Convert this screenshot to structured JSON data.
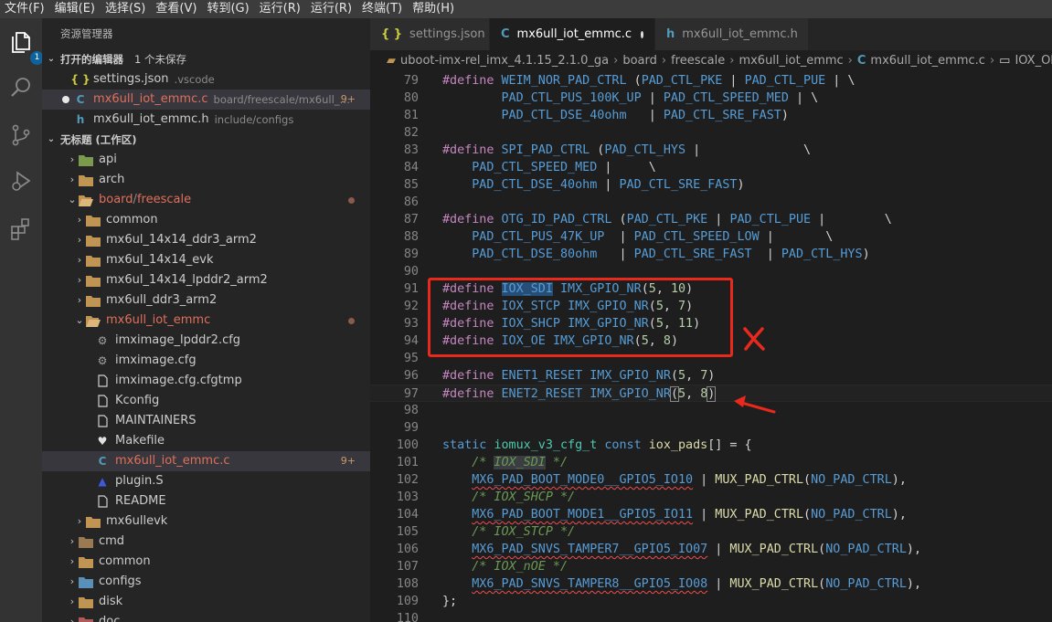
{
  "menubar": [
    "文件(F)",
    "编辑(E)",
    "选择(S)",
    "查看(V)",
    "转到(G)",
    "运行(R)",
    "运行(R)",
    "终端(T)",
    "帮助(H)"
  ],
  "activity": {
    "explorer_badge": "1"
  },
  "sidebar": {
    "title": "资源管理器",
    "open_editors": {
      "label": "打开的编辑器",
      "unsaved": "1 个未保存",
      "items": [
        {
          "icon": "{ }",
          "name": "settings.json",
          "desc": ".vscode"
        },
        {
          "icon": "C",
          "name": "mx6ull_iot_emmc.c",
          "desc": "board/freescale/mx6ull_i...",
          "badge": "9+"
        },
        {
          "icon": "h",
          "name": "mx6ull_iot_emmc.h",
          "desc": "include/configs"
        }
      ]
    },
    "workspace": {
      "label": "无标题 (工作区)",
      "tree": {
        "api": "api",
        "arch": "arch",
        "board": "board",
        "slash": " / ",
        "freescale": "freescale",
        "common": "common",
        "mx6ul_14x14_ddr3_arm2": "mx6ul_14x14_ddr3_arm2",
        "mx6ul_14x14_evk": "mx6ul_14x14_evk",
        "mx6ul_14x14_lpddr2_arm2": "mx6ul_14x14_lpddr2_arm2",
        "mx6ull_ddr3_arm2": "mx6ull_ddr3_arm2",
        "mx6ull_iot_emmc": "mx6ull_iot_emmc",
        "imximage_lpddr2": "imximage_lpddr2.cfg",
        "imximage": "imximage.cfg",
        "imximage_tmp": "imximage.cfg.cfgtmp",
        "kconfig": "Kconfig",
        "maintainers": "MAINTAINERS",
        "makefile": "Makefile",
        "emmc_c": "mx6ull_iot_emmc.c",
        "emmc_c_badge": "9+",
        "plugin": "plugin.S",
        "readme": "README",
        "mx6ullevk": "mx6ullevk",
        "cmd": "cmd",
        "common2": "common",
        "configs": "configs",
        "disk": "disk",
        "doc": "doc"
      }
    }
  },
  "tabs": [
    {
      "icon": "{ }",
      "label": "settings.json"
    },
    {
      "icon": "C",
      "label": "mx6ull_iot_emmc.c",
      "active": true,
      "dirty": true
    },
    {
      "icon": "h",
      "label": "mx6ull_iot_emmc.h"
    }
  ],
  "breadcrumb": [
    "uboot-imx-rel_imx_4.1.15_2.1.0_ga",
    "board",
    "freescale",
    "mx6ull_iot_emmc",
    "mx6ull_iot_emmc.c",
    "IOX_OE"
  ],
  "code": [
    {
      "n": "79",
      "t": [
        [
          "m",
          "#define "
        ],
        [
          "mac",
          "WEIM_NOR_PAD_CTRL"
        ],
        [
          "o",
          " ("
        ],
        [
          "mac",
          "PAD_CTL_PKE"
        ],
        [
          "o",
          " | "
        ],
        [
          "mac",
          "PAD_CTL_PUE"
        ],
        [
          "o",
          " | \\"
        ]
      ]
    },
    {
      "n": "80",
      "t": [
        [
          "o",
          "        "
        ],
        [
          "mac",
          "PAD_CTL_PUS_100K_UP"
        ],
        [
          "o",
          " | "
        ],
        [
          "mac",
          "PAD_CTL_SPEED_MED"
        ],
        [
          "o",
          " | \\"
        ]
      ]
    },
    {
      "n": "81",
      "t": [
        [
          "o",
          "        "
        ],
        [
          "mac",
          "PAD_CTL_DSE_40ohm"
        ],
        [
          "o",
          "   | "
        ],
        [
          "mac",
          "PAD_CTL_SRE_FAST"
        ],
        [
          "o",
          ")"
        ]
      ]
    },
    {
      "n": "82",
      "t": []
    },
    {
      "n": "83",
      "t": [
        [
          "m",
          "#define "
        ],
        [
          "mac",
          "SPI_PAD_CTRL"
        ],
        [
          "o",
          " ("
        ],
        [
          "mac",
          "PAD_CTL_HYS"
        ],
        [
          "o",
          " |              \\"
        ]
      ]
    },
    {
      "n": "84",
      "t": [
        [
          "o",
          "    "
        ],
        [
          "mac",
          "PAD_CTL_SPEED_MED"
        ],
        [
          "o",
          " |     \\"
        ]
      ]
    },
    {
      "n": "85",
      "t": [
        [
          "o",
          "    "
        ],
        [
          "mac",
          "PAD_CTL_DSE_40ohm"
        ],
        [
          "o",
          " | "
        ],
        [
          "mac",
          "PAD_CTL_SRE_FAST"
        ],
        [
          "o",
          ")"
        ]
      ]
    },
    {
      "n": "86",
      "t": []
    },
    {
      "n": "87",
      "t": [
        [
          "m",
          "#define "
        ],
        [
          "mac",
          "OTG_ID_PAD_CTRL"
        ],
        [
          "o",
          " ("
        ],
        [
          "mac",
          "PAD_CTL_PKE"
        ],
        [
          "o",
          " | "
        ],
        [
          "mac",
          "PAD_CTL_PUE"
        ],
        [
          "o",
          " |        \\"
        ]
      ]
    },
    {
      "n": "88",
      "t": [
        [
          "o",
          "    "
        ],
        [
          "mac",
          "PAD_CTL_PUS_47K_UP"
        ],
        [
          "o",
          "  | "
        ],
        [
          "mac",
          "PAD_CTL_SPEED_LOW"
        ],
        [
          "o",
          " |       \\"
        ]
      ]
    },
    {
      "n": "89",
      "t": [
        [
          "o",
          "    "
        ],
        [
          "mac",
          "PAD_CTL_DSE_80ohm"
        ],
        [
          "o",
          "   | "
        ],
        [
          "mac",
          "PAD_CTL_SRE_FAST"
        ],
        [
          "o",
          "  | "
        ],
        [
          "mac",
          "PAD_CTL_HYS"
        ],
        [
          "o",
          ")"
        ]
      ]
    },
    {
      "n": "90",
      "t": []
    },
    {
      "n": "91",
      "t": [
        [
          "m",
          "#define "
        ],
        [
          "sel",
          "IOX_SDI"
        ],
        [
          "o",
          " "
        ],
        [
          "mac",
          "IMX_GPIO_NR"
        ],
        [
          "o",
          "("
        ],
        [
          "num",
          "5"
        ],
        [
          "o",
          ", "
        ],
        [
          "num",
          "10"
        ],
        [
          "o",
          ")"
        ]
      ]
    },
    {
      "n": "92",
      "t": [
        [
          "m",
          "#define "
        ],
        [
          "mac",
          "IOX_STCP"
        ],
        [
          "o",
          " "
        ],
        [
          "mac",
          "IMX_GPIO_NR"
        ],
        [
          "o",
          "("
        ],
        [
          "num",
          "5"
        ],
        [
          "o",
          ", "
        ],
        [
          "num",
          "7"
        ],
        [
          "o",
          ")"
        ]
      ]
    },
    {
      "n": "93",
      "t": [
        [
          "m",
          "#define "
        ],
        [
          "mac",
          "IOX_SHCP"
        ],
        [
          "o",
          " "
        ],
        [
          "mac",
          "IMX_GPIO_NR"
        ],
        [
          "o",
          "("
        ],
        [
          "num",
          "5"
        ],
        [
          "o",
          ", "
        ],
        [
          "num",
          "11"
        ],
        [
          "o",
          ")"
        ]
      ]
    },
    {
      "n": "94",
      "t": [
        [
          "m",
          "#define "
        ],
        [
          "mac",
          "IOX_OE"
        ],
        [
          "o",
          " "
        ],
        [
          "mac",
          "IMX_GPIO_NR"
        ],
        [
          "o",
          "("
        ],
        [
          "num",
          "5"
        ],
        [
          "o",
          ", "
        ],
        [
          "num",
          "8"
        ],
        [
          "o",
          ")"
        ]
      ]
    },
    {
      "n": "95",
      "t": []
    },
    {
      "n": "96",
      "t": [
        [
          "m",
          "#define "
        ],
        [
          "mac",
          "ENET1_RESET"
        ],
        [
          "o",
          " "
        ],
        [
          "mac",
          "IMX_GPIO_NR"
        ],
        [
          "o",
          "("
        ],
        [
          "num",
          "5"
        ],
        [
          "o",
          ", "
        ],
        [
          "num",
          "7"
        ],
        [
          "o",
          ")"
        ]
      ]
    },
    {
      "n": "97",
      "t": [
        [
          "m",
          "#define "
        ],
        [
          "mac",
          "ENET2_RESET"
        ],
        [
          "o",
          " "
        ],
        [
          "mac",
          "IMX_GPIO_NR"
        ],
        [
          "br",
          "("
        ],
        [
          "num",
          "5"
        ],
        [
          "o",
          ", "
        ],
        [
          "num",
          "8"
        ],
        [
          "br",
          ")"
        ]
      ],
      "current": true
    },
    {
      "n": "98",
      "t": []
    },
    {
      "n": "99",
      "t": []
    },
    {
      "n": "100",
      "t": [
        [
          "mac",
          "static"
        ],
        [
          "o",
          " "
        ],
        [
          "type",
          "iomux_v3_cfg_t"
        ],
        [
          "o",
          " "
        ],
        [
          "mac",
          "const"
        ],
        [
          "o",
          " "
        ],
        [
          "fn",
          "iox_pads"
        ],
        [
          "o",
          "[] = {"
        ]
      ]
    },
    {
      "n": "101",
      "t": [
        [
          "o",
          "    "
        ],
        [
          "cm",
          "/* "
        ],
        [
          "cmh",
          "IOX_SDI"
        ],
        [
          "cm",
          " */"
        ]
      ]
    },
    {
      "n": "102",
      "t": [
        [
          "o",
          "    "
        ],
        [
          "wv",
          "MX6_PAD_BOOT_MODE0__GPIO5_IO10"
        ],
        [
          "o",
          " | "
        ],
        [
          "fn",
          "MUX_PAD_CTRL"
        ],
        [
          "o",
          "("
        ],
        [
          "mac",
          "NO_PAD_CTRL"
        ],
        [
          "o",
          "),"
        ]
      ]
    },
    {
      "n": "103",
      "t": [
        [
          "o",
          "    "
        ],
        [
          "cm",
          "/* IOX_SHCP */"
        ]
      ]
    },
    {
      "n": "104",
      "t": [
        [
          "o",
          "    "
        ],
        [
          "wv",
          "MX6_PAD_BOOT_MODE1__GPIO5_IO11"
        ],
        [
          "o",
          " | "
        ],
        [
          "fn",
          "MUX_PAD_CTRL"
        ],
        [
          "o",
          "("
        ],
        [
          "mac",
          "NO_PAD_CTRL"
        ],
        [
          "o",
          "),"
        ]
      ]
    },
    {
      "n": "105",
      "t": [
        [
          "o",
          "    "
        ],
        [
          "cm",
          "/* IOX_STCP */"
        ]
      ]
    },
    {
      "n": "106",
      "t": [
        [
          "o",
          "    "
        ],
        [
          "wv",
          "MX6_PAD_SNVS_TAMPER7__GPIO5_IO07"
        ],
        [
          "o",
          " | "
        ],
        [
          "fn",
          "MUX_PAD_CTRL"
        ],
        [
          "o",
          "("
        ],
        [
          "mac",
          "NO_PAD_CTRL"
        ],
        [
          "o",
          "),"
        ]
      ]
    },
    {
      "n": "107",
      "t": [
        [
          "o",
          "    "
        ],
        [
          "cm",
          "/* IOX_nOE */"
        ]
      ]
    },
    {
      "n": "108",
      "t": [
        [
          "o",
          "    "
        ],
        [
          "wv",
          "MX6_PAD_SNVS_TAMPER8__GPIO5_IO08"
        ],
        [
          "o",
          " | "
        ],
        [
          "fn",
          "MUX_PAD_CTRL"
        ],
        [
          "o",
          "("
        ],
        [
          "mac",
          "NO_PAD_CTRL"
        ],
        [
          "o",
          "),"
        ]
      ]
    },
    {
      "n": "109",
      "t": [
        [
          "o",
          "};"
        ]
      ]
    },
    {
      "n": "110",
      "t": []
    }
  ]
}
